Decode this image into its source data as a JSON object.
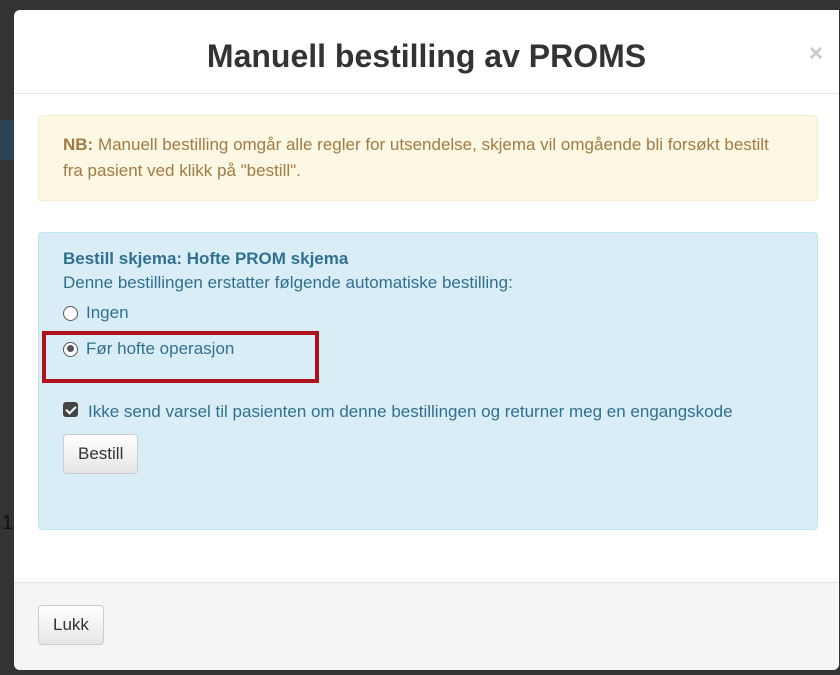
{
  "modal": {
    "title": "Manuell bestilling av PROMS",
    "close_symbol": "×"
  },
  "alert": {
    "label": "NB:",
    "text": " Manuell bestilling omgår alle regler for utsendelse, skjema vil omgående bli forsøkt bestilt fra pasient ved klikk på \"bestill\"."
  },
  "order_panel": {
    "heading": "Bestill skjema: Hofte PROM skjema",
    "description": "Denne bestillingen erstatter følgende automatiske bestilling:",
    "options": [
      {
        "label": "Ingen",
        "selected": false
      },
      {
        "label": "Før hofte operasjon",
        "selected": true
      }
    ],
    "no_notice_checkbox": {
      "label": "Ikke send varsel til pasienten om denne bestillingen og returner meg en engangskode",
      "checked": true
    },
    "order_button": "Bestill"
  },
  "footer": {
    "close_button": "Lukk"
  },
  "background": {
    "partial_text": "1"
  },
  "colors": {
    "warning_text": "#a27a43",
    "warning_bg": "#fcf8e3",
    "info_text": "#31708f",
    "info_bg": "#d9edf7",
    "highlight": "#b0101a"
  }
}
